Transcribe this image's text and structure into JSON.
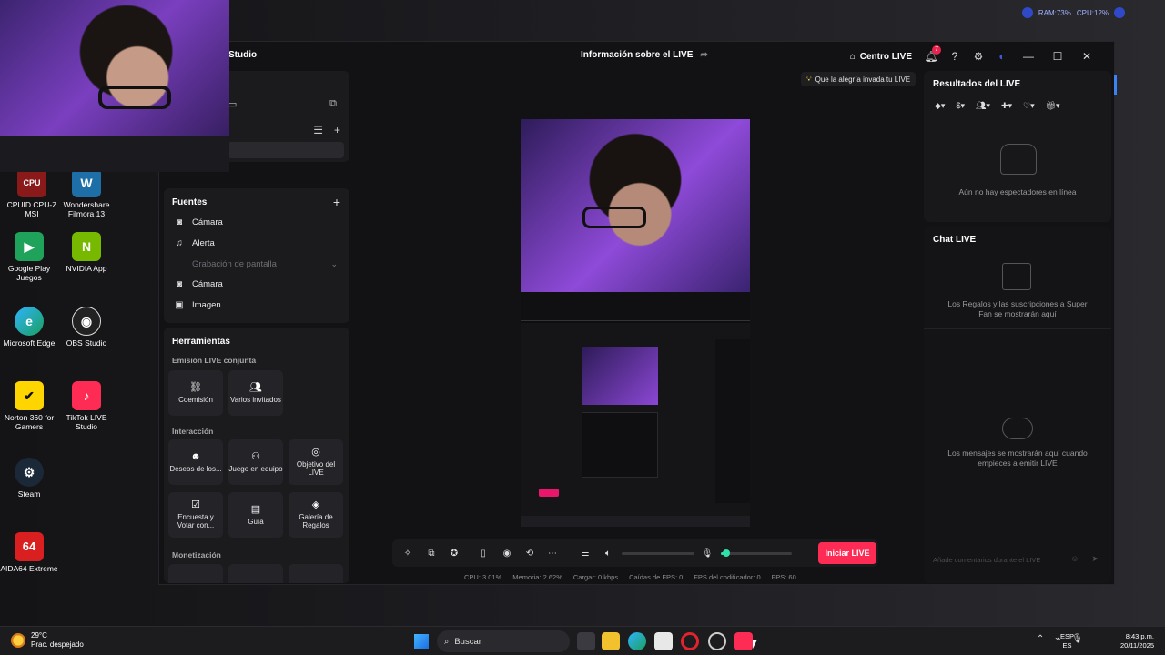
{
  "desktop": {
    "icons": [
      {
        "label": "CPUID CPU-Z MSI",
        "glyph": "CPU"
      },
      {
        "label": "Wondershare Filmora 13",
        "glyph": "W"
      },
      {
        "label": "Google Play Juegos",
        "glyph": "▶"
      },
      {
        "label": "NVIDIA App",
        "glyph": "N"
      },
      {
        "label": "Microsoft Edge",
        "glyph": "e"
      },
      {
        "label": "OBS Studio",
        "glyph": "◉"
      },
      {
        "label": "Norton 360 for Gamers",
        "glyph": "✔"
      },
      {
        "label": "TikTok LIVE Studio",
        "glyph": "♪"
      },
      {
        "label": "Steam",
        "glyph": "⚙"
      },
      {
        "label": "AIDA64 Extreme",
        "glyph": "64"
      }
    ],
    "sysmon": {
      "ram": "RAM:73%",
      "cpu": "CPU:12%"
    }
  },
  "app": {
    "name_fragment": "Studio",
    "live_info_title": "Información sobre el LIVE",
    "centro_live": "Centro LIVE",
    "notifications_count": "7",
    "tooltip": "Que la alegría invada tu LIVE"
  },
  "left": {
    "fuentes": {
      "title": "Fuentes",
      "items": [
        {
          "label": "Cámara",
          "icon": "camera-icon",
          "enabled": true
        },
        {
          "label": "Alerta",
          "icon": "bell-icon",
          "enabled": true
        },
        {
          "label": "Grabación de pantalla",
          "icon": "screen-record-icon",
          "enabled": false
        },
        {
          "label": "Cámara",
          "icon": "camera-icon",
          "enabled": true
        },
        {
          "label": "Imagen",
          "icon": "image-icon",
          "enabled": true
        }
      ]
    },
    "herramientas": {
      "title": "Herramientas",
      "sections": [
        {
          "title": "Emisión LIVE conjunta",
          "tools": [
            {
              "label": "Coemisión",
              "icon": "link-icon"
            },
            {
              "label": "Varios invitados",
              "icon": "guests-icon"
            }
          ]
        },
        {
          "title": "Interacción",
          "tools": [
            {
              "label": "Deseos de los...",
              "icon": "wishes-icon"
            },
            {
              "label": "Juego en equipo",
              "icon": "team-icon"
            },
            {
              "label": "Objetivo del LIVE",
              "icon": "goal-icon"
            },
            {
              "label": "Encuesta y Votar con...",
              "icon": "poll-icon"
            },
            {
              "label": "Guía",
              "icon": "guide-icon"
            },
            {
              "label": "Galería de Regalos",
              "icon": "gallery-icon"
            }
          ]
        },
        {
          "title": "Monetización",
          "tools": []
        }
      ]
    }
  },
  "center": {
    "start_live": "Iniciar LIVE",
    "mic_level": 0.08,
    "stats": {
      "cpu": "CPU: 3.01%",
      "memoria": "Memoria: 2.62%",
      "cargar": "Cargar: 0 kbps",
      "caidas": "Caídas de FPS: 0",
      "fps_cod": "FPS del codificador: 0",
      "fps": "FPS: 60"
    }
  },
  "right": {
    "results_title": "Resultados del LIVE",
    "results_empty": "Aún no hay espectadores en línea",
    "chat_title": "Chat LIVE",
    "gifts_msg": "Los Regalos y las suscripciones a Super Fan se mostrarán aquí",
    "chat_msg": "Los mensajes se mostrarán aquí cuando empieces a emitir LIVE",
    "chat_placeholder": "Añade comentarios durante el LIVE"
  },
  "taskbar": {
    "weather_temp": "29°C",
    "weather_desc": "Prac. despejado",
    "search": "Buscar",
    "lang_top": "ESP",
    "lang_bottom": "ES",
    "time": "8:43 p.m.",
    "date": "20/11/2025"
  },
  "colors": {
    "accent": "#fe2c55",
    "mic_level": "#2fe0a8",
    "panel": "#1b1b1e"
  }
}
